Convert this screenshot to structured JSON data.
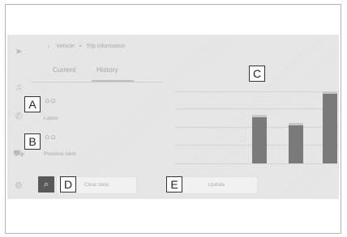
{
  "header": {
    "back_chevron": "‹",
    "breadcrumb_parent": "Vehicle",
    "breadcrumb_separator": "•",
    "breadcrumb_current": "Trip information"
  },
  "tabs": [
    {
      "label": "Current",
      "active": false
    },
    {
      "label": "History",
      "active": true
    }
  ],
  "sidebar_icons": [
    "navigation-icon",
    "music-icon",
    "phone-icon",
    "car-icon",
    "settings-icon"
  ],
  "items": [
    {
      "callout": "A",
      "value": "○○",
      "label": "Latest"
    },
    {
      "callout": "B",
      "value": "○○",
      "label": "Previous best"
    }
  ],
  "chart": {
    "callout": "C",
    "bars": [
      {
        "level": 0.67
      },
      {
        "level": 0.56
      },
      {
        "level": 1.0
      }
    ],
    "bar_color": "#7a7a7a"
  },
  "buttons": {
    "search_icon": "⌕",
    "clear_label": "Clear data",
    "clear_callout": "D",
    "update_label": "Update",
    "update_callout": "E"
  }
}
